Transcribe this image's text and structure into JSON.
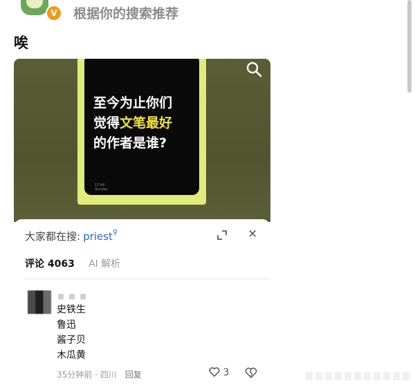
{
  "header": {
    "title": "根据你的搜索推荐",
    "badge": "V"
  },
  "post": {
    "title": "唉"
  },
  "video": {
    "text_line1": "至今为止你们",
    "text_line2_prefix": "觉得",
    "text_line2_highlight": "文笔最好",
    "text_line3": "的作者是谁?",
    "phone_time": "17:46",
    "phone_day": "Sunday"
  },
  "search_bar": {
    "label": "大家都在搜:",
    "term": "priest",
    "term_icon": "search-icon",
    "close_glyph": "×"
  },
  "tabs": [
    {
      "label": "评论 4063",
      "active": true
    },
    {
      "label": "AI 解析",
      "active": false
    }
  ],
  "comment": {
    "lines": [
      "史铁生",
      "鲁迅",
      "酱子贝",
      "木瓜黄"
    ],
    "meta_time_location": "35分钟前 · 四川",
    "reply_label": "回复",
    "like_count": "3"
  },
  "colors": {
    "accent_link": "#2a67c4",
    "highlight_yellow": "#f2e23d",
    "frame_yellow": "#dfeb7a",
    "badge_orange": "#f19a1b"
  }
}
